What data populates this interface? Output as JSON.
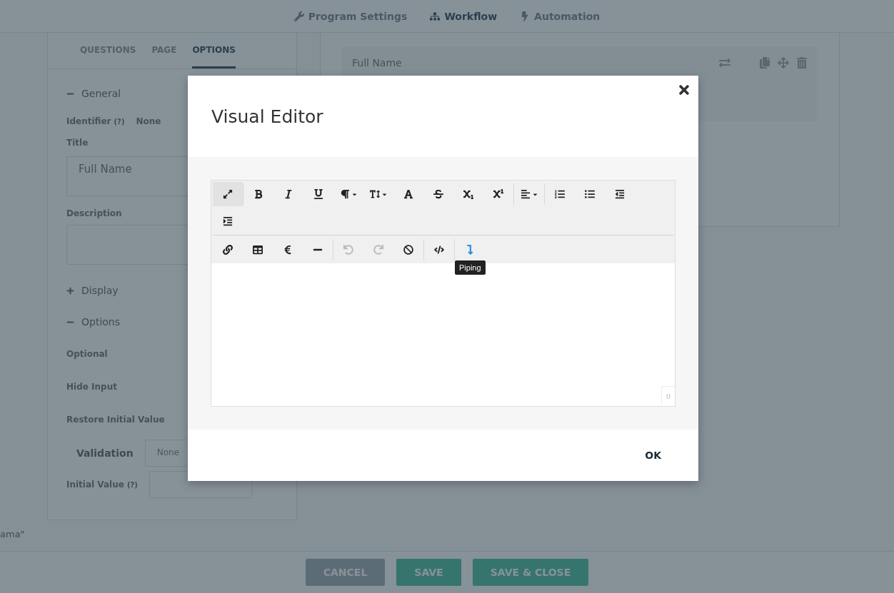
{
  "nav": {
    "tabs": [
      {
        "label": "Program Settings",
        "kind": "settings",
        "selected": false
      },
      {
        "label": "Workflow",
        "kind": "workflow",
        "selected": true
      },
      {
        "label": "Automation",
        "kind": "automation",
        "selected": false
      }
    ]
  },
  "panel": {
    "tabs": [
      {
        "label": "QUESTIONS",
        "selected": false
      },
      {
        "label": "PAGE",
        "selected": false
      },
      {
        "label": "OPTIONS",
        "selected": true
      }
    ],
    "general": {
      "title": "General",
      "expanded": true,
      "identifier_label": "Identifier",
      "identifier_help": "(?)",
      "identifier_value": "None",
      "title_label": "Title",
      "title_value": "Full Name",
      "description_label": "Description"
    },
    "display": {
      "title": "Display",
      "expanded": false
    },
    "options": {
      "title": "Options",
      "expanded": true,
      "rows": [
        {
          "label": "Optional"
        },
        {
          "label": "Hide Input"
        },
        {
          "label": "Restore Initial Value"
        }
      ],
      "validation_label": "Validation",
      "validation_value": "None",
      "initial_value_label": "Initial Value",
      "initial_value_help": "(?)"
    }
  },
  "canvas": {
    "question_title": "Full Name"
  },
  "footer": {
    "note": "ama\"",
    "buttons": [
      {
        "label": "CANCEL",
        "kind": "secondary"
      },
      {
        "label": "SAVE",
        "kind": "primary"
      },
      {
        "label": "SAVE & CLOSE",
        "kind": "primary"
      }
    ]
  },
  "dialog": {
    "title": "Visual Editor",
    "ok": "OK",
    "counter": "0",
    "lines": [
      [
        [
          {
            "kind": "fullscreen",
            "active": true,
            "disabled": false,
            "hovered": false
          }
        ],
        [
          {
            "kind": "bold",
            "active": false,
            "disabled": false,
            "hovered": false
          },
          {
            "kind": "italic",
            "active": false,
            "disabled": false,
            "hovered": false
          },
          {
            "kind": "underline",
            "active": false,
            "disabled": false,
            "hovered": false
          },
          {
            "kind": "paragraph",
            "active": false,
            "disabled": false,
            "hovered": false,
            "dropdown": true
          },
          {
            "kind": "fontsize",
            "active": false,
            "disabled": false,
            "hovered": false,
            "dropdown": true
          },
          {
            "kind": "color",
            "active": false,
            "disabled": false,
            "hovered": false
          },
          {
            "kind": "strike",
            "active": false,
            "disabled": false,
            "hovered": false
          },
          {
            "kind": "subscript",
            "active": false,
            "disabled": false,
            "hovered": false
          },
          {
            "kind": "superscript",
            "active": false,
            "disabled": false,
            "hovered": false
          }
        ],
        [
          {
            "kind": "align",
            "active": false,
            "disabled": false,
            "hovered": false,
            "dropdown": true
          }
        ],
        [
          {
            "kind": "ordered",
            "active": false,
            "disabled": false,
            "hovered": false
          },
          {
            "kind": "bullets",
            "active": false,
            "disabled": false,
            "hovered": false
          },
          {
            "kind": "outdent",
            "active": false,
            "disabled": false,
            "hovered": false
          }
        ]
      ],
      [
        [
          {
            "kind": "indent",
            "active": false,
            "disabled": false,
            "hovered": false
          }
        ]
      ],
      [
        [
          {
            "kind": "link",
            "active": false,
            "disabled": false,
            "hovered": false
          },
          {
            "kind": "table",
            "active": false,
            "disabled": false,
            "hovered": false
          },
          {
            "kind": "euro",
            "active": false,
            "disabled": false,
            "hovered": false
          },
          {
            "kind": "rule",
            "active": false,
            "disabled": false,
            "hovered": false
          }
        ],
        [
          {
            "kind": "undo",
            "active": false,
            "disabled": true,
            "hovered": false
          },
          {
            "kind": "redo",
            "active": false,
            "disabled": true,
            "hovered": false
          },
          {
            "kind": "clear",
            "active": false,
            "disabled": false,
            "hovered": false
          }
        ],
        [
          {
            "kind": "code",
            "active": false,
            "disabled": false,
            "hovered": false
          }
        ],
        [
          {
            "kind": "piping",
            "active": false,
            "disabled": false,
            "hovered": true,
            "tooltip": "Piping"
          }
        ]
      ]
    ]
  }
}
